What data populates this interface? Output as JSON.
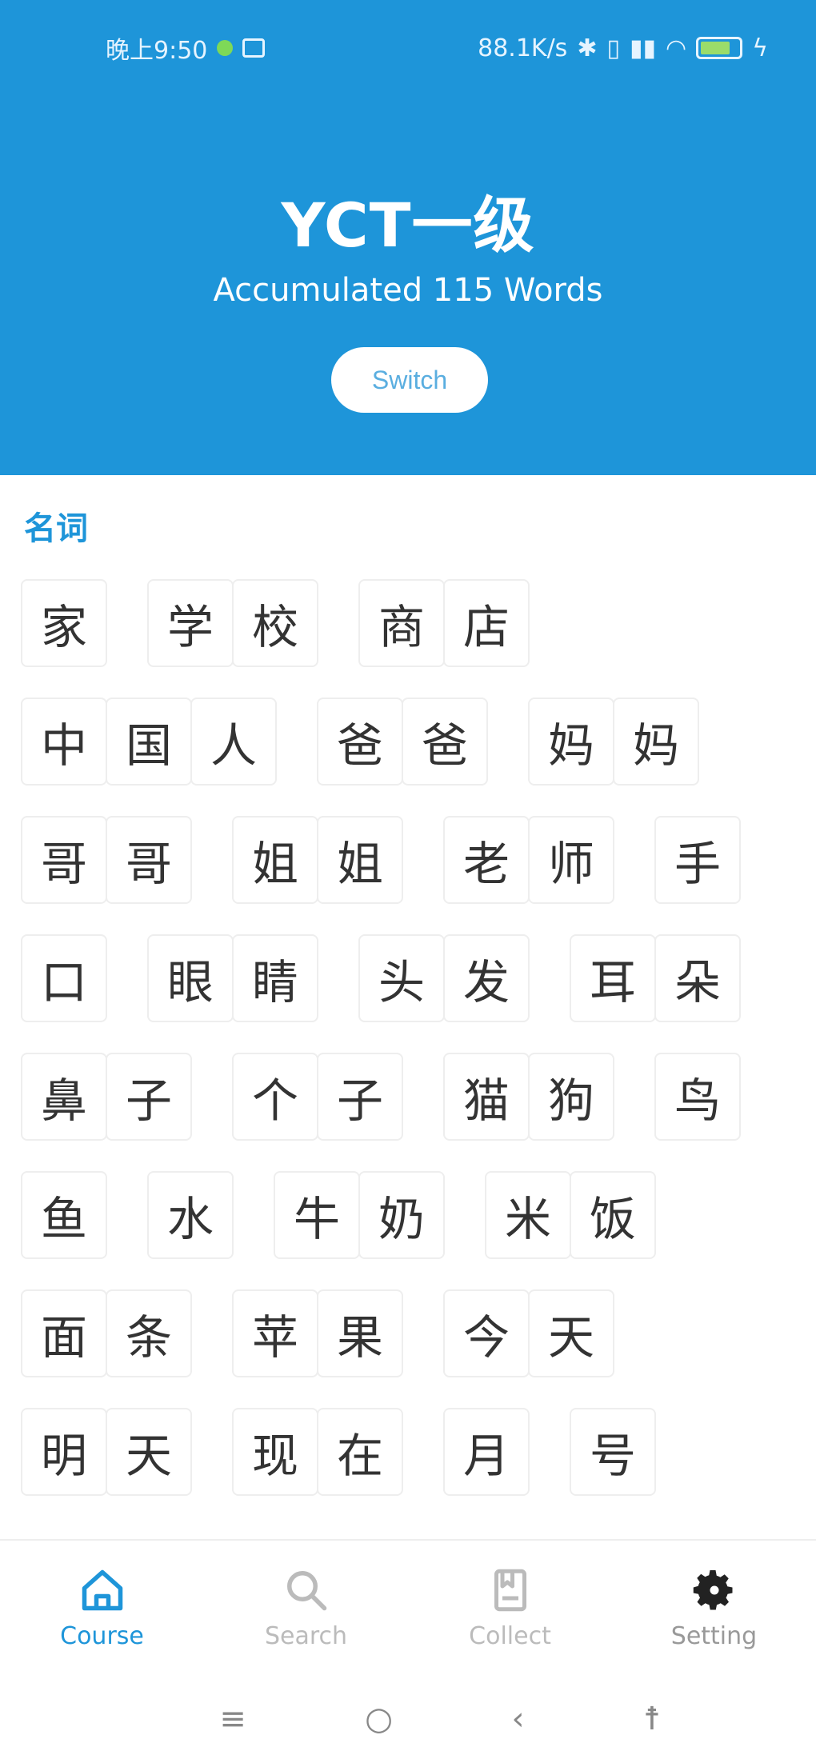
{
  "status_bar": {
    "time": "晚上9:50",
    "speed": "88.1K/s"
  },
  "header": {
    "title": "YCT一级",
    "count_text": "Accumulated 115 Words",
    "switch_label": "Switch"
  },
  "section": {
    "title": "名词"
  },
  "words": [
    [
      "家"
    ],
    [
      "学",
      "校"
    ],
    [
      "商",
      "店"
    ],
    [
      "中",
      "国",
      "人"
    ],
    [
      "爸",
      "爸"
    ],
    [
      "妈",
      "妈"
    ],
    [
      "哥",
      "哥"
    ],
    [
      "姐",
      "姐"
    ],
    [
      "老",
      "师"
    ],
    [
      "手"
    ],
    [
      "口"
    ],
    [
      "眼",
      "睛"
    ],
    [
      "头",
      "发"
    ],
    [
      "耳",
      "朵"
    ],
    [
      "鼻",
      "子"
    ],
    [
      "个",
      "子"
    ],
    [
      "猫",
      "狗"
    ],
    [
      "鸟"
    ],
    [
      "鱼"
    ],
    [
      "水"
    ],
    [
      "牛",
      "奶"
    ],
    [
      "米",
      "饭"
    ],
    [
      "面",
      "条"
    ],
    [
      "苹",
      "果"
    ],
    [
      "今",
      "天"
    ],
    [
      "明",
      "天"
    ],
    [
      "现",
      "在"
    ],
    [
      "月"
    ],
    [
      "号"
    ]
  ],
  "tabs": [
    {
      "label": "Course",
      "icon": "home-icon"
    },
    {
      "label": "Search",
      "icon": "search-icon"
    },
    {
      "label": "Collect",
      "icon": "collect-icon"
    },
    {
      "label": "Setting",
      "icon": "gear-icon"
    }
  ],
  "colors": {
    "primary": "#1e95d9"
  }
}
